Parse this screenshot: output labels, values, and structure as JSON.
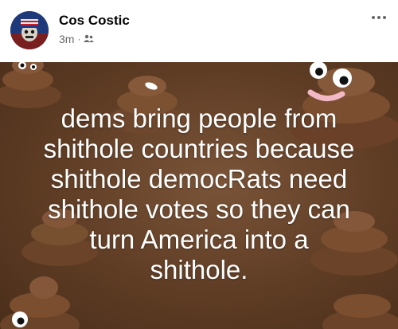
{
  "post": {
    "author": "Cos Costic",
    "time": "3m",
    "separator": "·",
    "audience_icon": "friends-icon",
    "menu_icon": "more-horizontal-icon",
    "text_lines": [
      "dems bring people from",
      "shithole countries because",
      "shithole democRats need",
      "shithole votes so they can",
      "turn America into a",
      "shithole."
    ],
    "background_color": "#5e3c24"
  }
}
